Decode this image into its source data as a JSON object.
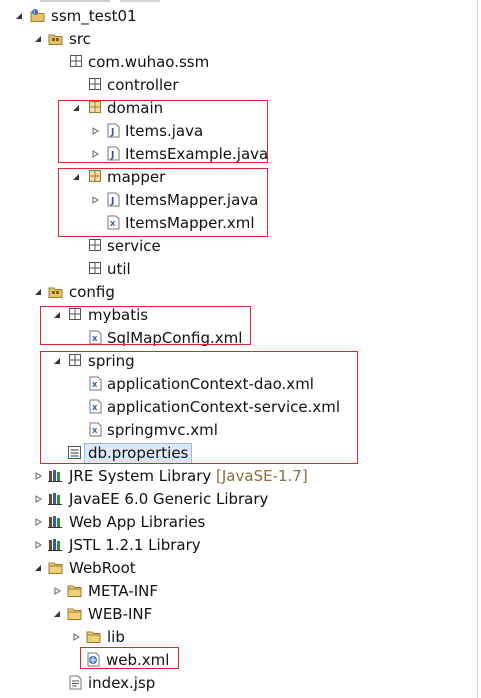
{
  "explorer": {
    "project": {
      "name": "ssm_test01",
      "icon": "java-project-icon",
      "twisty": "expanded"
    },
    "src": {
      "name": "src",
      "icon": "source-folder-icon",
      "twisty": "expanded"
    },
    "pkg_root": {
      "name": "com.wuhao.ssm",
      "icon": "package-icon"
    },
    "pkg_controller": {
      "name": "controller",
      "icon": "package-icon"
    },
    "pkg_domain": {
      "name": "domain",
      "icon": "package-icon",
      "twisty": "expanded"
    },
    "file_items": {
      "name": "Items.java",
      "icon": "java-file-icon",
      "twisty": "collapsed"
    },
    "file_items_example": {
      "name": "ItemsExample.java",
      "icon": "java-file-icon",
      "twisty": "collapsed"
    },
    "pkg_mapper": {
      "name": "mapper",
      "icon": "package-icon",
      "twisty": "expanded"
    },
    "file_items_mapper_java": {
      "name": "ItemsMapper.java",
      "icon": "java-file-icon",
      "twisty": "collapsed"
    },
    "file_items_mapper_xml": {
      "name": "ItemsMapper.xml",
      "icon": "xml-file-icon"
    },
    "pkg_service": {
      "name": "service",
      "icon": "package-icon"
    },
    "pkg_util": {
      "name": "util",
      "icon": "package-icon"
    },
    "config": {
      "name": "config",
      "icon": "source-folder-icon",
      "twisty": "expanded"
    },
    "pkg_mybatis": {
      "name": "mybatis",
      "icon": "package-icon",
      "twisty": "expanded"
    },
    "file_sqlmapconfig": {
      "name": "SqlMapConfig.xml",
      "icon": "xml-file-icon"
    },
    "pkg_spring": {
      "name": "spring",
      "icon": "package-icon",
      "twisty": "expanded"
    },
    "file_appctx_dao": {
      "name": "applicationContext-dao.xml",
      "icon": "xml-file-icon"
    },
    "file_appctx_service": {
      "name": "applicationContext-service.xml",
      "icon": "xml-file-icon"
    },
    "file_springmvc": {
      "name": "springmvc.xml",
      "icon": "xml-file-icon"
    },
    "file_db_properties": {
      "name": "db.properties",
      "icon": "properties-file-icon",
      "selected": true
    },
    "lib_jre": {
      "name": "JRE System Library",
      "suffix": "[JavaSE-1.7]",
      "icon": "library-icon",
      "twisty": "collapsed"
    },
    "lib_javaee": {
      "name": "JavaEE 6.0 Generic Library",
      "icon": "library-icon",
      "twisty": "collapsed"
    },
    "lib_webapp": {
      "name": "Web App Libraries",
      "icon": "library-icon",
      "twisty": "collapsed"
    },
    "lib_jstl": {
      "name": "JSTL 1.2.1 Library",
      "icon": "library-icon",
      "twisty": "collapsed"
    },
    "webroot": {
      "name": "WebRoot",
      "icon": "folder-icon",
      "twisty": "expanded"
    },
    "meta_inf": {
      "name": "META-INF",
      "icon": "folder-icon",
      "twisty": "collapsed"
    },
    "web_inf": {
      "name": "WEB-INF",
      "icon": "folder-icon",
      "twisty": "expanded"
    },
    "lib_folder": {
      "name": "lib",
      "icon": "folder-icon",
      "twisty": "collapsed"
    },
    "file_web_xml": {
      "name": "web.xml",
      "icon": "web-xml-file-icon"
    },
    "file_index_jsp": {
      "name": "index.jsp",
      "icon": "jsp-file-icon"
    }
  },
  "colors": {
    "highlight_box": "#e0242b",
    "selection": "#dde8f7",
    "library_suffix": "#8a6d3b"
  }
}
